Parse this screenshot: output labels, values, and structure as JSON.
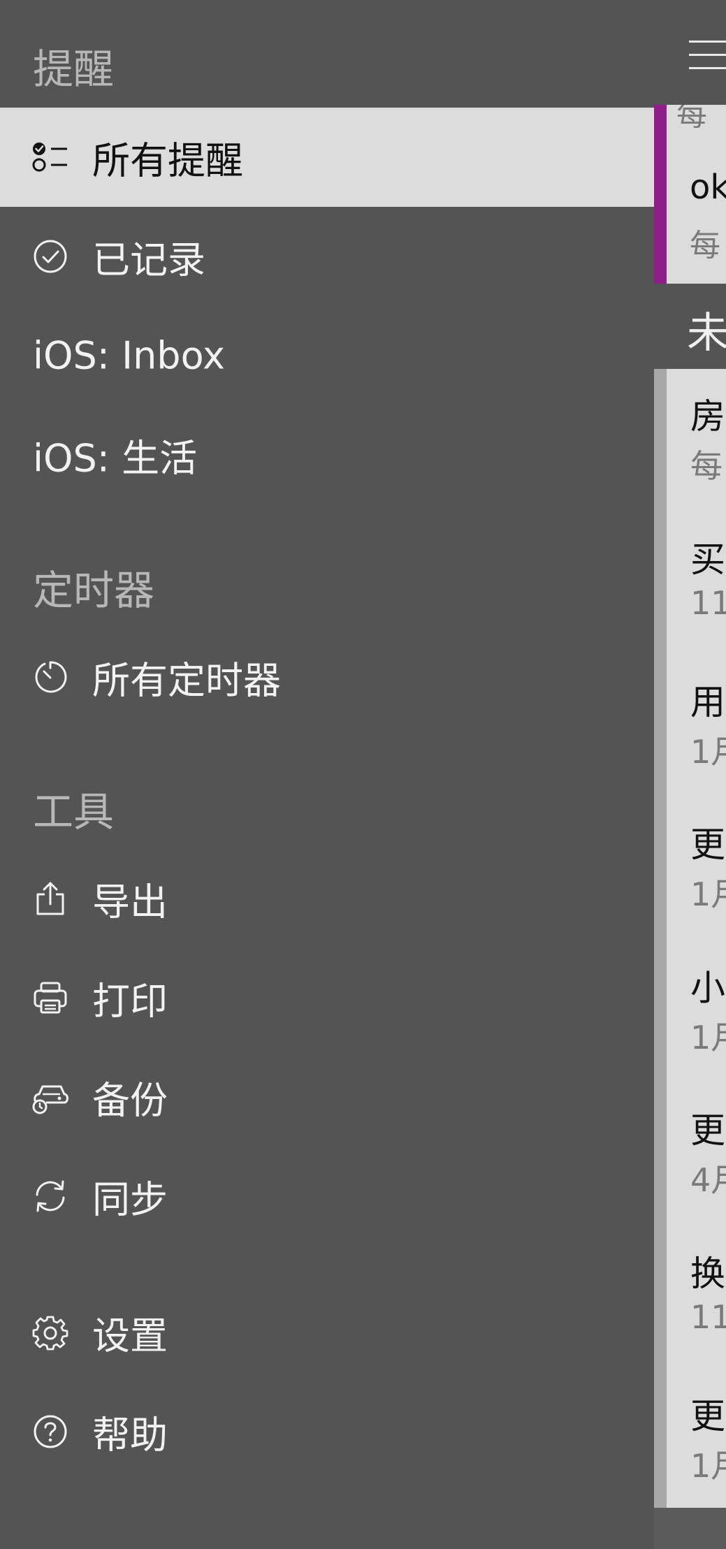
{
  "drawer": {
    "reminders_section": {
      "title": "提醒",
      "items": [
        {
          "label": "所有提醒",
          "icon": "checklist-icon",
          "selected": true
        },
        {
          "label": "已记录",
          "icon": "check-circle-icon"
        },
        {
          "label": "iOS: Inbox"
        },
        {
          "label": "iOS: 生活"
        }
      ]
    },
    "timers_section": {
      "title": "定时器",
      "items": [
        {
          "label": "所有定时器",
          "icon": "timer-icon"
        }
      ]
    },
    "tools_section": {
      "title": "工具",
      "items": [
        {
          "label": "导出",
          "icon": "export-icon"
        },
        {
          "label": "打印",
          "icon": "printer-icon"
        },
        {
          "label": "备份",
          "icon": "backup-icon"
        },
        {
          "label": "同步",
          "icon": "sync-icon"
        }
      ]
    },
    "footer_items": [
      {
        "label": "设置",
        "icon": "gear-icon"
      },
      {
        "label": "帮助",
        "icon": "help-icon"
      }
    ]
  },
  "background_list": {
    "menu_icon": "hamburger-icon",
    "accent_color": "#8e1f8a",
    "pinned": {
      "peek_sub_top": "每",
      "title": "ok",
      "sub": "每"
    },
    "section_header": "未",
    "items": [
      {
        "title": "房",
        "sub": "每"
      },
      {
        "title": "买",
        "sub": "11"
      },
      {
        "title": "用",
        "sub": "1月"
      },
      {
        "title": "更",
        "sub": "1月"
      },
      {
        "title": "小",
        "sub": "1月"
      },
      {
        "title": "更",
        "sub": "4月"
      },
      {
        "title": "换",
        "sub": "11"
      },
      {
        "title": "更",
        "sub": "1月"
      }
    ]
  },
  "colors": {
    "drawer_bg": "#545454",
    "selected_bg": "#dcdcdc",
    "section_title": "#b7b7b7",
    "item_text": "#f2f2f2"
  }
}
